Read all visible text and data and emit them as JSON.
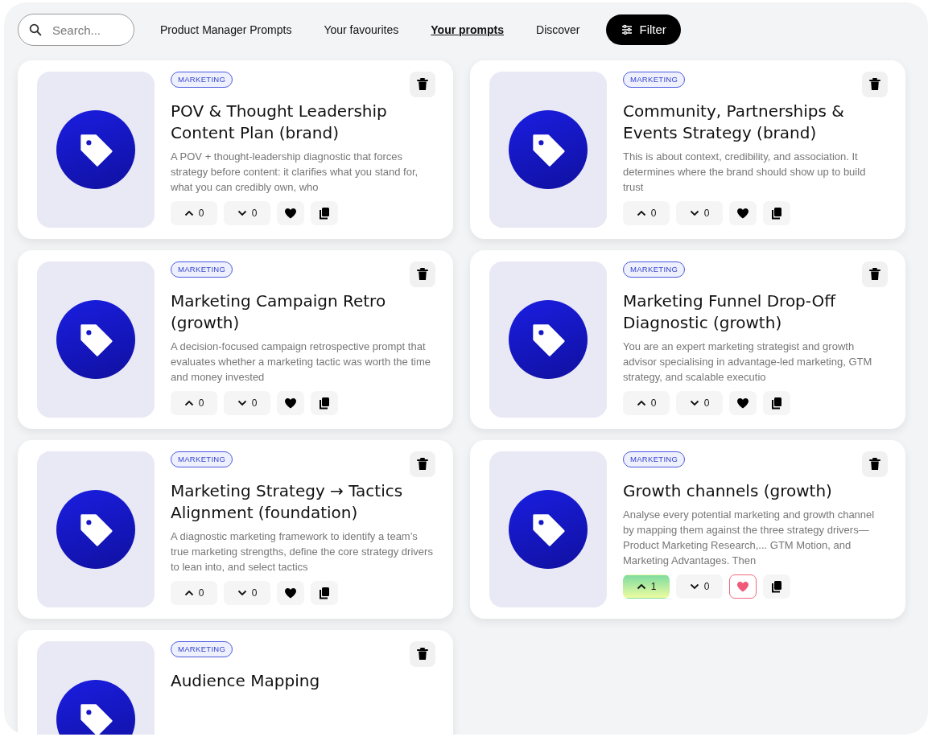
{
  "search": {
    "placeholder": "Search..."
  },
  "nav_links": [
    {
      "label": "Product Manager Prompts",
      "selected": false
    },
    {
      "label": "Your favourites",
      "selected": false
    },
    {
      "label": "Your prompts",
      "selected": true
    },
    {
      "label": "Discover",
      "selected": false
    }
  ],
  "filter_button": "Filter",
  "cards": [
    {
      "tag": "MARKETING",
      "title": "POV & Thought Leadership Content Plan (brand)",
      "description": "A POV + thought-leadership diagnostic that forces strategy before content: it clarifies what you stand for, what you can credibly own, who",
      "upvotes": "0",
      "downvotes": "0",
      "upvoted": false,
      "favourite": false
    },
    {
      "tag": "MARKETING",
      "title": "Community, Partnerships & Events Strategy (brand)",
      "description": "This is about context, credibility, and association. It determines where the brand should show up to build trust",
      "upvotes": "0",
      "downvotes": "0",
      "upvoted": false,
      "favourite": false
    },
    {
      "tag": "MARKETING",
      "title": "Marketing Campaign Retro (growth)",
      "description": "A decision-focused campaign retrospective prompt that evaluates whether a marketing tactic was worth the time and money invested",
      "upvotes": "0",
      "downvotes": "0",
      "upvoted": false,
      "favourite": false
    },
    {
      "tag": "MARKETING",
      "title": "Marketing Funnel Drop-Off Diagnostic (growth)",
      "description": "You are an expert marketing strategist and growth advisor specialising in advantage-led marketing, GTM strategy, and scalable executio",
      "upvotes": "0",
      "downvotes": "0",
      "upvoted": false,
      "favourite": false
    },
    {
      "tag": "MARKETING",
      "title": "Marketing Strategy → Tactics Alignment (foundation)",
      "description": "A diagnostic marketing framework to identify a team’s true marketing strengths, define the core strategy drivers to lean into, and select tactics",
      "upvotes": "0",
      "downvotes": "0",
      "upvoted": false,
      "favourite": false
    },
    {
      "tag": "MARKETING",
      "title": "Growth channels (growth)",
      "description": "Analyse every potential marketing and growth channel by mapping them against the three strategy drivers—Product Marketing Research,... GTM Motion, and Marketing Advantages. Then",
      "upvotes": "1",
      "downvotes": "0",
      "upvoted": true,
      "favourite": true
    },
    {
      "tag": "MARKETING",
      "title": "Audience Mapping"
    }
  ]
}
